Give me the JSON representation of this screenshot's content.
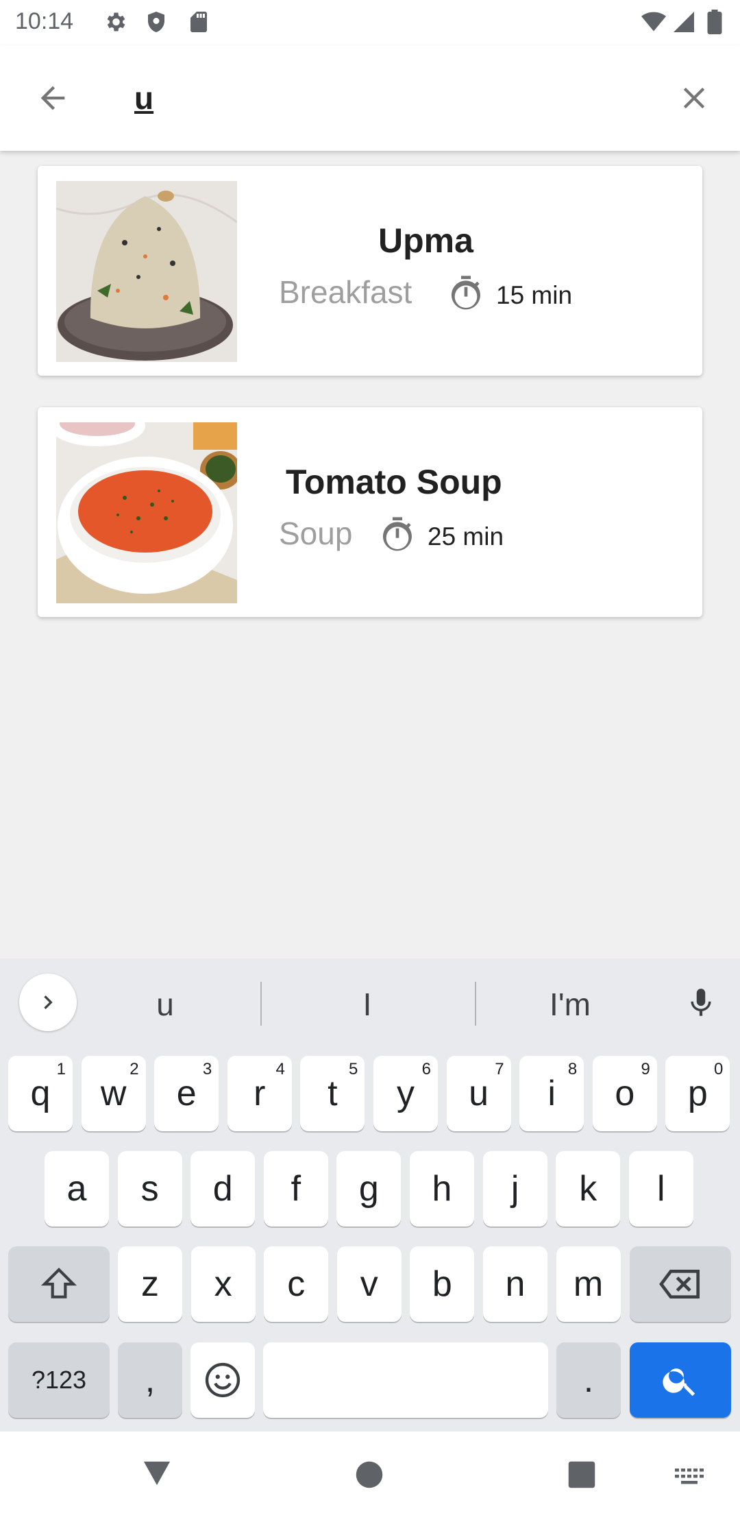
{
  "status_bar": {
    "time": "10:14",
    "left_icons": [
      "settings-gear-icon",
      "shield-icon",
      "sd-card-icon"
    ],
    "right_icons": [
      "wifi-icon",
      "cell-signal-icon",
      "battery-icon"
    ]
  },
  "search": {
    "query": "u",
    "back_icon": "arrow-back-icon",
    "clear_icon": "close-icon"
  },
  "results": [
    {
      "title": "Upma",
      "category": "Breakfast",
      "time": "15 min",
      "image": "upma-photo"
    },
    {
      "title": "Tomato Soup",
      "category": "Soup",
      "time": "25 min",
      "image": "tomato-soup-photo"
    }
  ],
  "keyboard": {
    "suggestions": [
      "u",
      "I",
      "I'm"
    ],
    "row1": [
      {
        "k": "q",
        "h": "1"
      },
      {
        "k": "w",
        "h": "2"
      },
      {
        "k": "e",
        "h": "3"
      },
      {
        "k": "r",
        "h": "4"
      },
      {
        "k": "t",
        "h": "5"
      },
      {
        "k": "y",
        "h": "6"
      },
      {
        "k": "u",
        "h": "7"
      },
      {
        "k": "i",
        "h": "8"
      },
      {
        "k": "o",
        "h": "9"
      },
      {
        "k": "p",
        "h": "0"
      }
    ],
    "row2": [
      "a",
      "s",
      "d",
      "f",
      "g",
      "h",
      "j",
      "k",
      "l"
    ],
    "row3": [
      "z",
      "x",
      "c",
      "v",
      "b",
      "n",
      "m"
    ],
    "symbols_label": "?123",
    "comma_label": ",",
    "period_label": ".",
    "search_key_color": "#1a73e8"
  },
  "nav_bar": {
    "icons": [
      "back-triangle-icon",
      "home-circle-icon",
      "recents-square-icon",
      "keyboard-switch-icon"
    ]
  }
}
